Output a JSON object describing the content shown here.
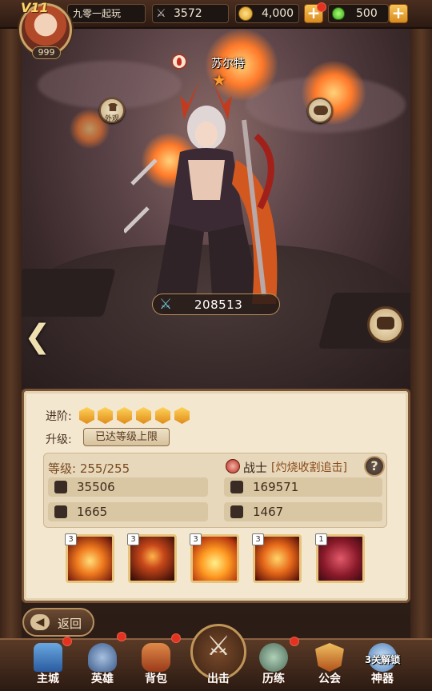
{
  "player": {
    "name": "九零一起玩",
    "vip": "V11",
    "level": "999"
  },
  "resources": {
    "power": "3572",
    "coins": "4,000",
    "potions": "500"
  },
  "hero": {
    "name": "苏尔特",
    "battle_power": "208513",
    "rank_label": "进阶:",
    "rank_stars": 6,
    "upgrade_label": "升级:",
    "upgrade_status": "已达等级上限",
    "level_text": "等级: 255/255",
    "class_text": "战士",
    "class_skill": "[灼烧收割追击]",
    "stats": {
      "attack": "35506",
      "hp": "169571",
      "defense": "1665",
      "speed": "1467"
    },
    "skills": [
      {
        "level": "3"
      },
      {
        "level": "3"
      },
      {
        "level": "3"
      },
      {
        "level": "3"
      },
      {
        "level": "1"
      }
    ]
  },
  "scene_buttons": {
    "skin_label": "外观"
  },
  "back_label": "返回",
  "nav": [
    {
      "label": "主城"
    },
    {
      "label": "英雄"
    },
    {
      "label": "背包"
    },
    {
      "label": "出击"
    },
    {
      "label": "历练"
    },
    {
      "label": "公会"
    },
    {
      "label": "神器"
    }
  ],
  "nav_badge": "3关解锁",
  "colors": {
    "accent": "#e08c1a",
    "panel": "#f3e7d0",
    "reddot": "#e3331f"
  }
}
